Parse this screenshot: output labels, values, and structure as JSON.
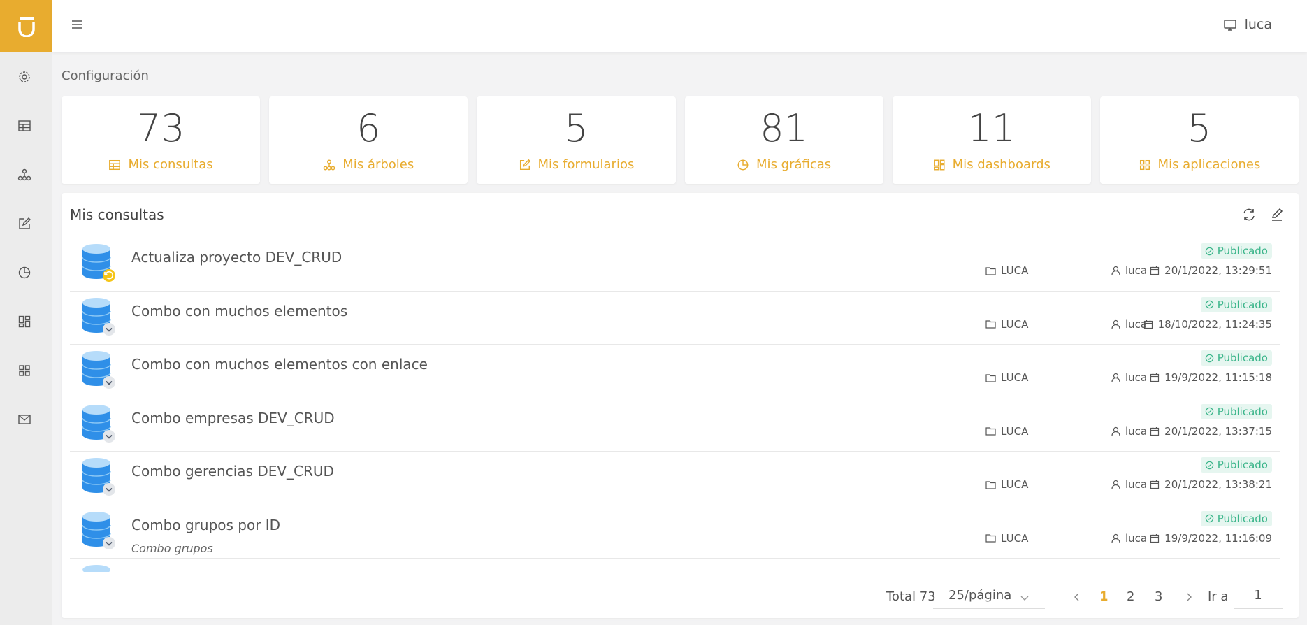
{
  "header": {
    "user": "luca"
  },
  "breadcrumb": "Configuración",
  "stats": [
    {
      "count": "73",
      "label": "Mis consultas",
      "icon": "table-icon"
    },
    {
      "count": "6",
      "label": "Mis árboles",
      "icon": "tree-icon"
    },
    {
      "count": "5",
      "label": "Mis formularios",
      "icon": "edit-icon"
    },
    {
      "count": "81",
      "label": "Mis gráficas",
      "icon": "pie-chart-icon"
    },
    {
      "count": "11",
      "label": "Mis dashboards",
      "icon": "dashboard-icon"
    },
    {
      "count": "5",
      "label": "Mis aplicaciones",
      "icon": "apps-icon"
    }
  ],
  "panel": {
    "title": "Mis consultas",
    "rows": [
      {
        "title": "Actualiza proyecto DEV_CRUD",
        "subtitle": "",
        "status": "Publicado",
        "folder": "LUCA",
        "user": "luca",
        "date": "20/1/2022, 13:29:51",
        "badge": "refresh"
      },
      {
        "title": "Combo con muchos elementos",
        "subtitle": "",
        "status": "Publicado",
        "folder": "LUCA",
        "user": "luca",
        "date": "18/10/2022, 11:24:35",
        "badge": "chevron"
      },
      {
        "title": "Combo con muchos elementos con enlace",
        "subtitle": "",
        "status": "Publicado",
        "folder": "LUCA",
        "user": "luca",
        "date": "19/9/2022, 11:15:18",
        "badge": "chevron"
      },
      {
        "title": "Combo empresas DEV_CRUD",
        "subtitle": "",
        "status": "Publicado",
        "folder": "LUCA",
        "user": "luca",
        "date": "20/1/2022, 13:37:15",
        "badge": "chevron"
      },
      {
        "title": "Combo gerencias DEV_CRUD",
        "subtitle": "",
        "status": "Publicado",
        "folder": "LUCA",
        "user": "luca",
        "date": "20/1/2022, 13:38:21",
        "badge": "chevron"
      },
      {
        "title": "Combo grupos por ID",
        "subtitle": "Combo grupos",
        "status": "Publicado",
        "folder": "LUCA",
        "user": "luca",
        "date": "19/9/2022, 11:16:09",
        "badge": "chevron"
      }
    ]
  },
  "pagination": {
    "total": "Total 73",
    "page_size": "25/página",
    "pages": [
      "1",
      "2",
      "3"
    ],
    "goto_label": "Ir a",
    "goto_value": "1"
  },
  "colors": {
    "accent": "#e8ac2f",
    "success": "#3bb58a",
    "db_blue": "#2f8fe8"
  }
}
